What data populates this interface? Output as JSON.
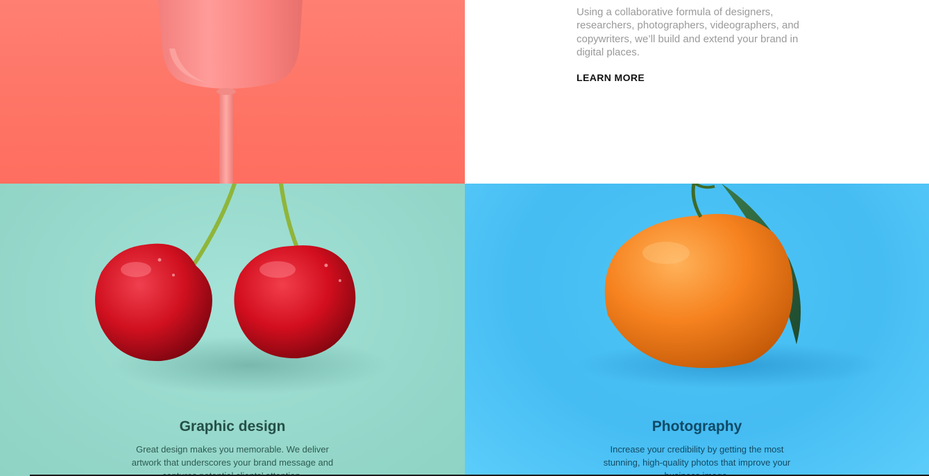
{
  "intro": {
    "paragraph": "Using a collaborative formula of designers, researchers, photographers, videographers, and copywriters, we’ll build and extend your brand in digital places.",
    "cta_label": "LEARN MORE"
  },
  "services": [
    {
      "title": "Graphic design",
      "description": "Great design makes you memorable. We deliver artwork that underscores your brand message and captures potential clients’ attention."
    },
    {
      "title": "Photography",
      "description": "Increase your credibility by getting the most stunning, high-quality photos that improve your business image."
    }
  ],
  "colors": {
    "coral_background": "#fe7465",
    "mint_background": "#97d9cc",
    "sky_background": "#45bcf2"
  },
  "images": [
    "pink-glass-image",
    "cherries-image",
    "orange-image"
  ]
}
